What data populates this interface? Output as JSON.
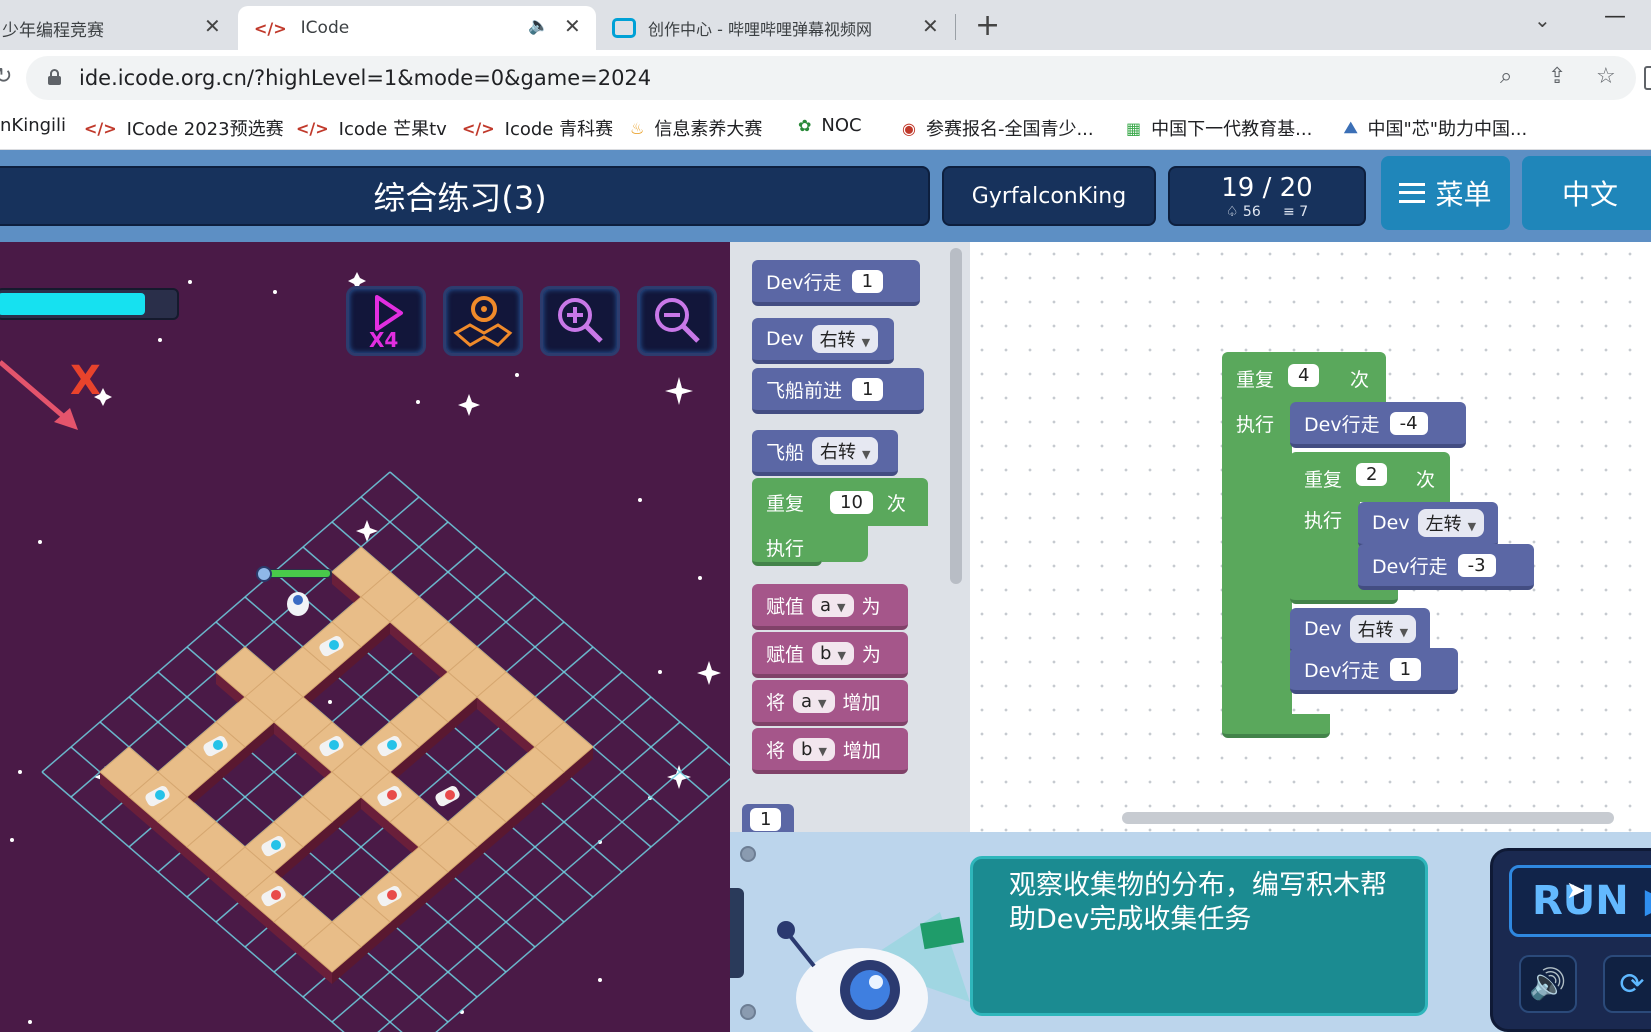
{
  "browser": {
    "tabs": [
      {
        "title": "少年编程竞赛"
      },
      {
        "title": "ICode"
      },
      {
        "title": "创作中心 - 哔哩哔哩弹幕视频网"
      }
    ],
    "new_tab": "+",
    "url": "ide.icode.org.cn/?highLevel=1&mode=0&game=2024",
    "bookmarks": [
      "nKingili",
      "ICode 2023预选赛",
      "Icode 芒果tv",
      "Icode 青科赛",
      "信息素养大赛",
      "NOC",
      "参赛报名-全国青少...",
      "中国下一代教育基...",
      "中国\"芯\"助力中国..."
    ]
  },
  "header": {
    "title": "综合练习(3)",
    "username": "GyrfalconKing",
    "progress": "19 / 20",
    "stat_a": "56",
    "stat_b": "7",
    "menu_label": "菜单",
    "lang_label": "中文"
  },
  "stage": {
    "hp_fraction": 0.82,
    "mark": "X",
    "speed_label": "X4"
  },
  "toolbox": {
    "dev_walk": "Dev行走",
    "dev_walk_val": "1",
    "dev": "Dev",
    "dev_turn": "右转",
    "ship_forward": "飞船前进",
    "ship_forward_val": "1",
    "ship": "飞船",
    "ship_turn": "右转",
    "repeat": "重复",
    "repeat_val": "10",
    "times": "次",
    "exec": "执行",
    "assign": "赋值",
    "var_a": "a",
    "var_b": "b",
    "as": "为",
    "jiang": "将",
    "increase": "增加",
    "number_block": "1"
  },
  "workspace": {
    "outer_repeat": "重复",
    "outer_repeat_val": "4",
    "times": "次",
    "exec": "执行",
    "walk1": "Dev行走",
    "walk1_val": "-4",
    "inner_repeat": "重复",
    "inner_repeat_val": "2",
    "inner_exec": "执行",
    "dev": "Dev",
    "turn_left": "左转",
    "walk2": "Dev行走",
    "walk2_val": "-3",
    "turn_right": "右转",
    "walk3": "Dev行走",
    "walk3_val": "1"
  },
  "bottom": {
    "tip": "观察收集物的分布，编写积木帮助Dev完成收集任务",
    "run": "RUN"
  },
  "colors": {
    "game_bg": "#4a1a47",
    "header_bg": "#17325c",
    "accent": "#1f86ba",
    "tile": "#e8bd88",
    "grid": "#6fd0e0"
  }
}
